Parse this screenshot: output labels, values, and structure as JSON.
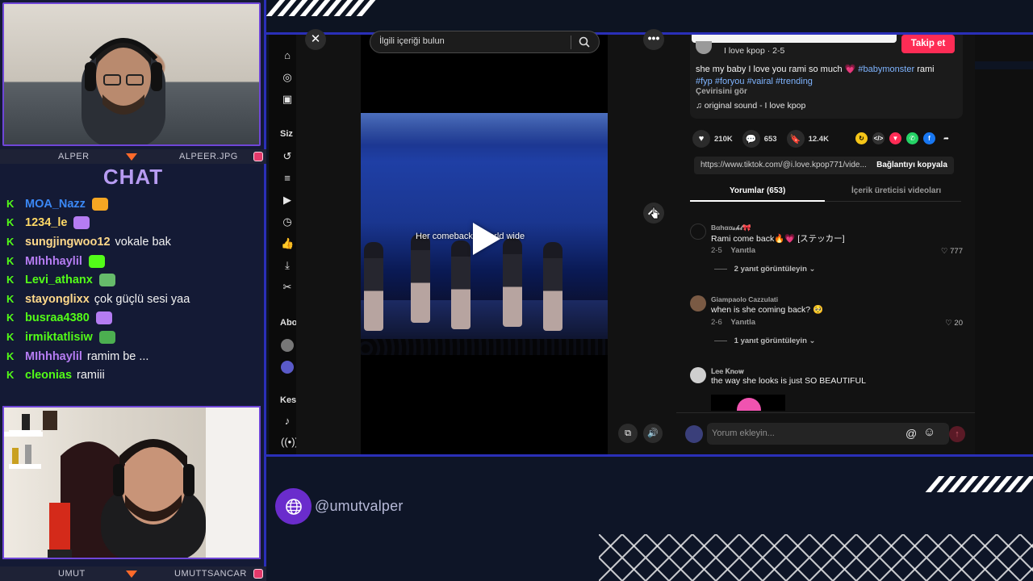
{
  "overlay": {
    "social_handle": "@umutvalper",
    "accent_color": "#2a2fb8",
    "icon": "globe-icon"
  },
  "cam_top": {
    "name_left": "ALPER",
    "name_right": "ALPEER.JPG"
  },
  "cam_bottom": {
    "name_left": "UMUT",
    "name_right": "UMUTTSANCAR"
  },
  "chat": {
    "title": "CHAT",
    "messages": [
      {
        "user": "MOA_Nazz",
        "user_color": "#3b88f5",
        "message": "",
        "emote": "emote"
      },
      {
        "user": "1234_le",
        "user_color": "#ffd966",
        "message": "",
        "emote": "emote"
      },
      {
        "user": "sungjingwoo12",
        "user_color": "#ffd98a",
        "message": "vokale bak",
        "emote": ""
      },
      {
        "user": "MIhhhaylil",
        "user_color": "#b57cf2",
        "message": "",
        "emote": "emote"
      },
      {
        "user": "Levi_athanx",
        "user_color": "#53fc18",
        "message": "",
        "emote": "emote"
      },
      {
        "user": "stayonglixx",
        "user_color": "#ffd98a",
        "message": "çok güçlü sesi yaa",
        "emote": ""
      },
      {
        "user": "busraa4380",
        "user_color": "#53fc18",
        "message": "",
        "emote": "emote"
      },
      {
        "user": "irmiktatlisiw",
        "user_color": "#53fc18",
        "message": "",
        "emote": "emote"
      },
      {
        "user": "MIhhhaylil",
        "user_color": "#b57cf2",
        "message": "ramim be ...",
        "emote": ""
      },
      {
        "user": "cleonias",
        "user_color": "#53fc18",
        "message": "ramiii",
        "emote": ""
      }
    ]
  },
  "tiktok": {
    "search_placeholder": "İlgili içeriği bulun",
    "nav_labels": {
      "siz": "Siz",
      "abone": "Abo",
      "kesfet": "Kes"
    },
    "video_caption": "Her comeback  e world wide",
    "author_line": "I love kpop · 2-5",
    "follow_label": "Takip et",
    "description": {
      "text": "she my baby I love you rami so much",
      "hashtag_inline": "#babymonster",
      "text_after": "rami",
      "hashtags": "#fyp #foryou #vairal #trending"
    },
    "see_translation": "Çevirisini gör",
    "sound": "original sound - I love kpop",
    "stats": {
      "likes": "210K",
      "comments": "653",
      "saves": "12.4K"
    },
    "link_url": "https://www.tiktok.com/@i.love.kpop771/vide...",
    "copy_link_label": "Bağlantıyı kopyala",
    "tabs": {
      "comments": "Yorumlar (653)",
      "creator_videos": "İçerik üreticisi videoları"
    },
    "comments": [
      {
        "user": "Bαhαα𝓼𝓱𝓽🎀",
        "text": "Rami come back🔥💗 [ステッカー]",
        "date": "2-5",
        "reply": "Yanıtla",
        "likes": "777",
        "replies": "2 yanıt görüntüleyin"
      },
      {
        "user": "Giampaolo Cazzulati",
        "text": "when is she coming back? 🥺",
        "date": "2-6",
        "reply": "Yanıtla",
        "likes": "20",
        "replies": "1 yanıt görüntüleyin"
      },
      {
        "user": "𝐋𝐞𝐞 𝐊𝐧𝐨𝐰",
        "text": "the way she looks is just SO BEAUTIFUL",
        "date": "",
        "reply": "",
        "likes": "",
        "replies": ""
      }
    ],
    "comment_placeholder": "Yorum ekleyin...",
    "brand_color": "#fe2c55"
  }
}
